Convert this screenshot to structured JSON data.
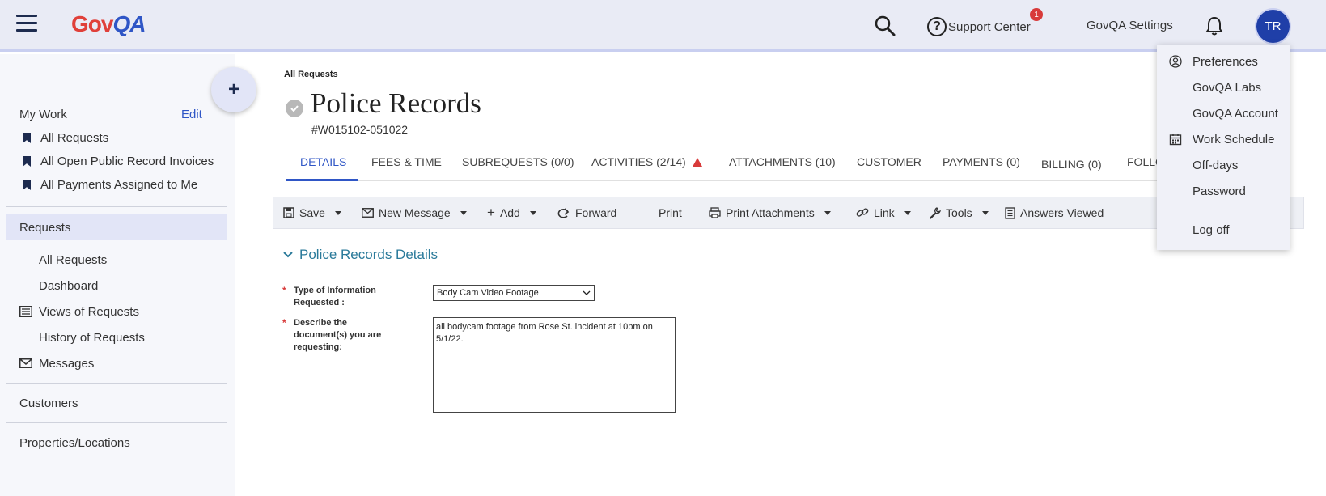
{
  "header": {
    "logo_gov": "Gov",
    "logo_qa": "QA",
    "support_label": "Support Center",
    "support_badge": "1",
    "settings_label": "GovQA Settings",
    "avatar_initials": "TR"
  },
  "sidebar": {
    "fab_label": "+",
    "my_work": "My Work",
    "edit": "Edit",
    "bookmarks": [
      "All Requests",
      "All Open Public Record Invoices",
      "All Payments Assigned to Me"
    ],
    "requests": "Requests",
    "sub_items": [
      "All Requests",
      "Dashboard",
      "Views of Requests",
      "History of Requests",
      "Messages"
    ],
    "customers": "Customers",
    "properties": "Properties/Locations"
  },
  "main": {
    "breadcrumb": "All Requests",
    "title": "Police Records",
    "request_id": "#W015102-051022",
    "tabs": [
      "DETAILS",
      "FEES & TIME",
      "SUBREQUESTS (0/0)",
      "ACTIVITIES (2/14)",
      "ATTACHMENTS (10)",
      "CUSTOMER",
      "PAYMENTS (0)",
      "BILLING (0)",
      "FOLLO"
    ],
    "toolbar": {
      "save": "Save",
      "new_message": "New Message",
      "add": "Add",
      "forward": "Forward",
      "print": "Print",
      "print_attachments": "Print Attachments",
      "link": "Link",
      "tools": "Tools",
      "answers_viewed": "Answers Viewed"
    },
    "section_title": "Police Records Details",
    "fields": {
      "type_label": "Type of Information Requested :",
      "type_value": "Body Cam Video Footage",
      "describe_label": "Describe the  document(s) you are requesting:",
      "describe_value": "all bodycam footage from Rose St. incident at 10pm on 5/1/22."
    }
  },
  "user_menu": {
    "items": [
      "Preferences",
      "GovQA Labs",
      "GovQA Account",
      "Work Schedule",
      "Off-days",
      "Password"
    ],
    "logoff": "Log off"
  },
  "colors": {
    "accent": "#2f56c6",
    "header_bg": "#e9ebf5",
    "avatar_bg": "#1f3fa8",
    "alert_red": "#d83a3a",
    "section_teal": "#2a7a9a"
  }
}
